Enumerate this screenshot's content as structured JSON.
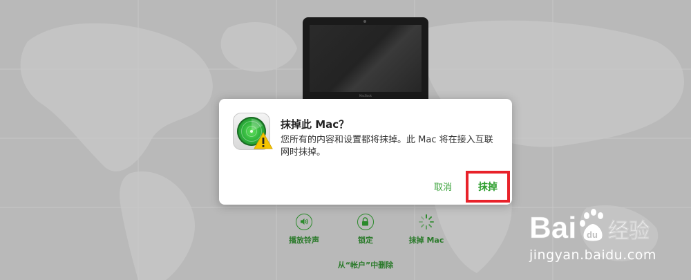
{
  "device": {
    "brand_text": "MacBook"
  },
  "dialog": {
    "title": "抹掉此 Mac？",
    "body": "您所有的内容和设置都将抹掉。此 Mac 将在接入互联网时抹掉。",
    "cancel_label": "取消",
    "erase_label": "抹掉",
    "icon": "find-my-radar-icon",
    "warning_icon": "warning-icon"
  },
  "actions": {
    "play_sound_label": "播放铃声",
    "lock_label": "锁定",
    "erase_mac_label": "抹掉 Mac"
  },
  "remove_link": "从“帐户”中删除",
  "watermark": {
    "logo_text": "Bai",
    "logo_text2": "du",
    "logo_suffix": "经验",
    "url": "jingyan.baidu.com"
  },
  "colors": {
    "accent_green": "#2f9e2f",
    "highlight_red": "#e8222a",
    "background": "#b7b7b7"
  }
}
